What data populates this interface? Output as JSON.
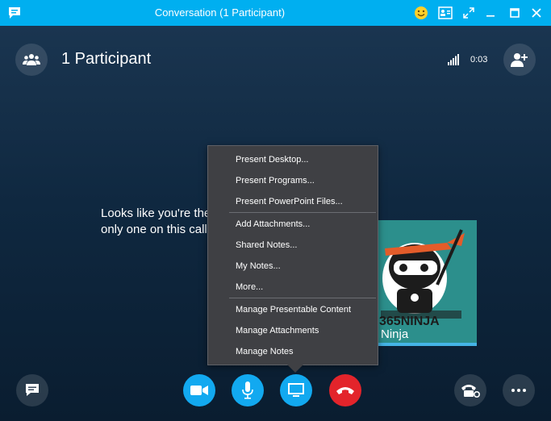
{
  "window": {
    "title": "Conversation (1 Participant)"
  },
  "header": {
    "participants_label": "1 Participant",
    "call_timer": "0:03"
  },
  "stage": {
    "alone_message": "Looks like you're the only one on this call."
  },
  "participant_tile": {
    "name": "Ninja",
    "logo_text": "365NINJA"
  },
  "share_menu": {
    "items": [
      "Present Desktop...",
      "Present Programs...",
      "Present PowerPoint Files...",
      "Add Attachments...",
      "Shared Notes...",
      "My Notes...",
      "More...",
      "Manage Presentable Content",
      "Manage Attachments",
      "Manage Notes"
    ]
  },
  "colors": {
    "titlebar": "#00aff0",
    "accent_blue": "#12a9f0",
    "hangup_red": "#e3242b",
    "menu_bg": "#3f4044"
  }
}
